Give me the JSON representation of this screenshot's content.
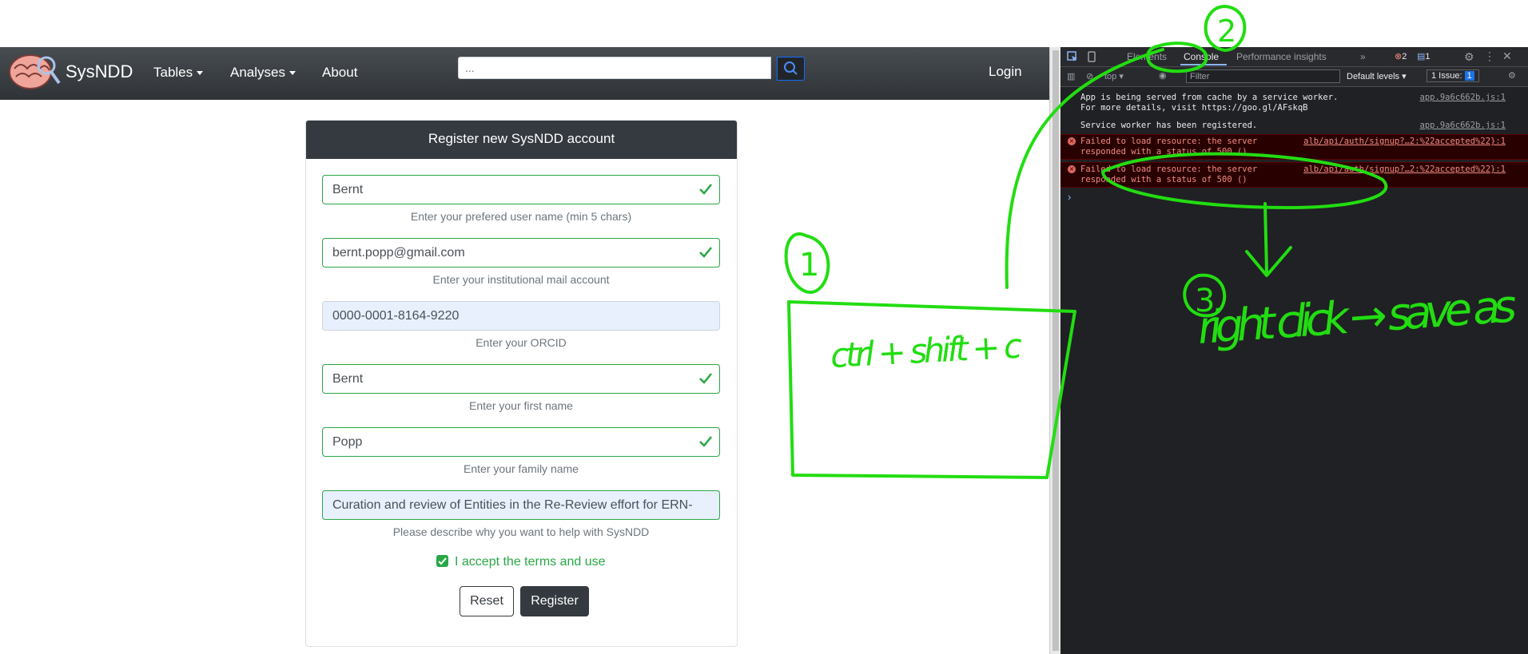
{
  "app": {
    "brand": "SysNDD",
    "nav": {
      "tables": "Tables",
      "analyses": "Analyses",
      "about": "About",
      "login": "Login"
    },
    "search": {
      "placeholder": "..."
    },
    "form": {
      "title": "Register new SysNDD account",
      "fields": [
        {
          "value": "Bernt",
          "hint": "Enter your prefered user name (min 5 chars)"
        },
        {
          "value": "bernt.popp@gmail.com",
          "hint": "Enter your institutional mail account"
        },
        {
          "value": "0000-0001-8164-9220",
          "hint": "Enter your ORCID"
        },
        {
          "value": "Bernt",
          "hint": "Enter your first name"
        },
        {
          "value": "Popp",
          "hint": "Enter your family name"
        },
        {
          "value": "Curation and review of Entities in the Re-Review effort for ERN-",
          "hint": "Please describe why you want to help with SysNDD"
        }
      ],
      "terms": "I accept the terms and use",
      "reset": "Reset",
      "register": "Register"
    }
  },
  "devtools": {
    "tabs": {
      "elements": "Elements",
      "console": "Console",
      "performance": "Performance insights",
      "errors": "2",
      "messages": "1"
    },
    "sub": {
      "top": "top",
      "filter": "Filter",
      "levels": "Default levels",
      "issues": "1 Issue:",
      "issue_count": "1"
    },
    "logs": [
      {
        "msg": "App is being served from cache by a service worker.\nFor more details, visit https://goo.gl/AFskqB",
        "src": "app.9a6c662b.js:1"
      },
      {
        "msg": "Service worker has been registered.",
        "src": "app.9a6c662b.js:1"
      },
      {
        "msg": "Failed to load resource: the server\nresponded with a status of 500 ()",
        "src": "alb/api/auth/signup?…2:%22accepted%22}:1"
      },
      {
        "msg": "Failed to load resource: the server\nresponded with a status of 500 ()",
        "src": "alb/api/auth/signup?…2:%22accepted%22}:1"
      }
    ]
  },
  "annotations": {
    "step1": "1",
    "step2": "2",
    "step3": "3",
    "shortcut": "ctrl + shift + c",
    "instruction": "right click → save as"
  },
  "colors": {
    "accent_green": "#28a745",
    "navbar": "#343a40",
    "annotation": "#22dd11"
  }
}
